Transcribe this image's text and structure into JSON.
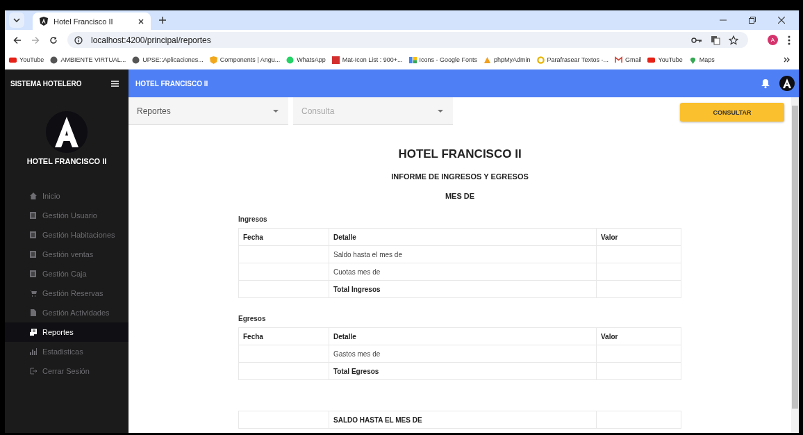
{
  "browser": {
    "tab_title": "Hotel Francisco II",
    "url": "localhost:4200/principal/reportes",
    "profile_letter": "A",
    "bookmarks": [
      {
        "label": "YouTube",
        "kind": "youtube"
      },
      {
        "label": "AMBIENTE VIRTUAL...",
        "kind": "globe"
      },
      {
        "label": "UPSE::Aplicaciones...",
        "kind": "globe"
      },
      {
        "label": "Components | Angu...",
        "kind": "shield"
      },
      {
        "label": "WhatsApp",
        "kind": "whatsapp"
      },
      {
        "label": "Mat-Icon List : 900+...",
        "kind": "letter"
      },
      {
        "label": "Icons - Google Fonts",
        "kind": "fonts"
      },
      {
        "label": "phpMyAdmin",
        "kind": "sail"
      },
      {
        "label": "Parafrasear Textos -...",
        "kind": "ring"
      },
      {
        "label": "Gmail",
        "kind": "mail"
      },
      {
        "label": "YouTube",
        "kind": "youtube"
      },
      {
        "label": "Maps",
        "kind": "pin"
      }
    ]
  },
  "sidebar": {
    "title": "SISTEMA HOTELERO",
    "brand": "HOTEL FRANCISCO II",
    "items": [
      {
        "label": "Inicio",
        "kind": "home",
        "selected": false
      },
      {
        "label": "Gestión Usuario",
        "kind": "doc",
        "selected": false
      },
      {
        "label": "Gestión Habitaciones",
        "kind": "doc",
        "selected": false
      },
      {
        "label": "Gestión ventas",
        "kind": "doc",
        "selected": false
      },
      {
        "label": "Gestión Caja",
        "kind": "doc",
        "selected": false
      },
      {
        "label": "Gestión Reservas",
        "kind": "cart",
        "selected": false
      },
      {
        "label": "Gestión Actividades",
        "kind": "file",
        "selected": false
      },
      {
        "label": "Reportes",
        "kind": "report",
        "selected": true
      },
      {
        "label": "Estadisticas",
        "kind": "chart",
        "selected": false
      },
      {
        "label": "Cerrar Sesión",
        "kind": "logout",
        "selected": false
      }
    ]
  },
  "header": {
    "title": "HOTEL FRANCISCO II"
  },
  "filters": [
    {
      "value": "Reportes"
    },
    {
      "placeholder": "Consulta"
    }
  ],
  "consult_button": "CONSULTAR",
  "report": {
    "title": "HOTEL FRANCISCO II",
    "subtitle": "INFORME DE INGRESOS Y EGRESOS",
    "period": "MES DE",
    "sections": [
      {
        "heading": "Ingresos",
        "columns": [
          "Fecha",
          "Detalle",
          "Valor"
        ],
        "rows": [
          {
            "detail": "Saldo hasta el mes de",
            "kind": "item"
          },
          {
            "detail": "Cuotas mes de",
            "kind": "item"
          },
          {
            "detail": "Total Ingresos",
            "kind": "total"
          }
        ]
      },
      {
        "heading": "Egresos",
        "columns": [
          "Fecha",
          "Detalle",
          "Valor"
        ],
        "rows": [
          {
            "detail": "Gastos mes de",
            "kind": "item"
          },
          {
            "detail": "Total Egresos",
            "kind": "total"
          }
        ]
      },
      {
        "rows": [
          {
            "detail": "SALDO HASTA EL MES DE",
            "kind": "total"
          }
        ]
      }
    ]
  }
}
